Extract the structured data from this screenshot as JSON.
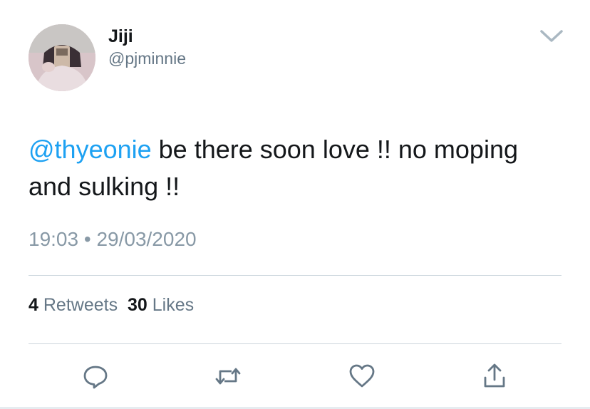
{
  "tweet": {
    "display_name": "Jiji",
    "handle": "@pjminnie",
    "text": {
      "mention": "@thyeonie",
      "body": " be there soon love !! no moping and sulking !!"
    },
    "time": "19:03",
    "separator": "•",
    "date": "29/03/2020",
    "stats": {
      "retweets_count": "4",
      "retweets_label": "Retweets",
      "likes_count": "30",
      "likes_label": "Likes"
    }
  },
  "icons": {
    "menu": "chevron-down-icon",
    "reply": "reply-icon",
    "retweet": "retweet-icon",
    "like": "heart-icon",
    "share": "share-icon"
  },
  "colors": {
    "mention": "#1da1f2",
    "text": "#14171a",
    "secondary": "#657786",
    "muted": "#8899a6",
    "divider": "#ccd6dd"
  }
}
